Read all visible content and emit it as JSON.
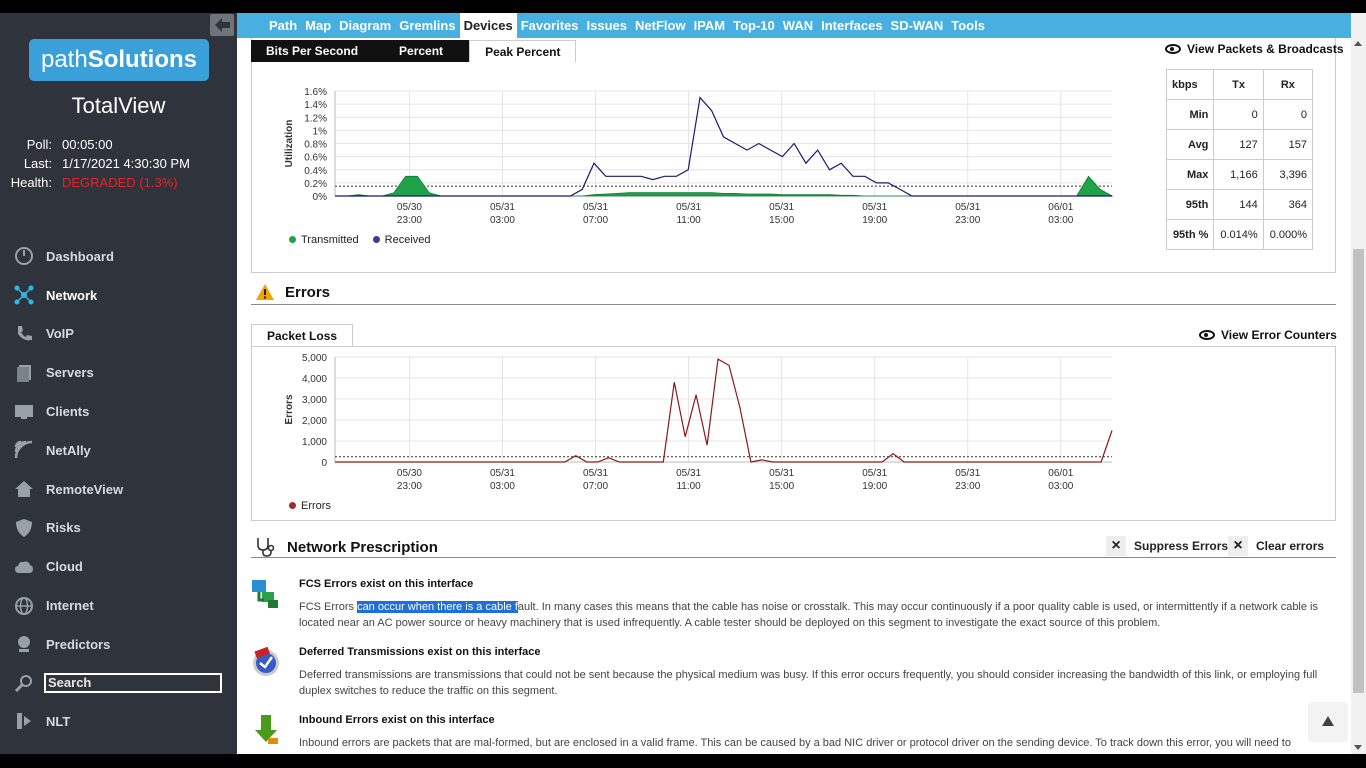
{
  "sidebar": {
    "logo": {
      "part1": "path",
      "part2": "Solutions"
    },
    "product": "TotalView",
    "poll_label": "Poll:",
    "poll_value": "00:05:00",
    "last_label": "Last:",
    "last_value": "1/17/2021 4:30:30 PM",
    "health_label": "Health:",
    "health_value": "DEGRADED (1.3%)",
    "items": [
      {
        "label": "Dashboard",
        "icon": "gauge-icon"
      },
      {
        "label": "Network",
        "icon": "network-icon"
      },
      {
        "label": "VoIP",
        "icon": "phone-icon"
      },
      {
        "label": "Servers",
        "icon": "server-icon"
      },
      {
        "label": "Clients",
        "icon": "monitor-icon"
      },
      {
        "label": "NetAlly",
        "icon": "signal-icon"
      },
      {
        "label": "RemoteView",
        "icon": "home-icon"
      },
      {
        "label": "Risks",
        "icon": "shield-icon"
      },
      {
        "label": "Cloud",
        "icon": "cloud-icon"
      },
      {
        "label": "Internet",
        "icon": "globe-icon"
      },
      {
        "label": "Predictors",
        "icon": "predictor-icon"
      }
    ],
    "search_placeholder": "Search",
    "nlt_label": "NLT"
  },
  "topnav": [
    "Path",
    "Map",
    "Diagram",
    "Gremlins",
    "Devices",
    "Favorites",
    "Issues",
    "NetFlow",
    "IPAM",
    "Top-10",
    "WAN",
    "Interfaces",
    "SD-WAN",
    "Tools"
  ],
  "utilization": {
    "tabs": [
      "Bits Per Second",
      "Percent",
      "Peak Percent"
    ],
    "view_link": "View Packets & Broadcasts",
    "ylabel": "Utilization",
    "legend": [
      "Transmitted",
      "Received"
    ],
    "table": {
      "headers": [
        "kbps",
        "Tx",
        "Rx"
      ],
      "rows": [
        [
          "Min",
          "0",
          "0"
        ],
        [
          "Avg",
          "127",
          "157"
        ],
        [
          "Max",
          "1,166",
          "3,396"
        ],
        [
          "95th",
          "144",
          "364"
        ],
        [
          "95th %",
          "0.014%",
          "0.000%"
        ]
      ]
    }
  },
  "errors": {
    "title": "Errors",
    "tab": "Packet Loss",
    "view_link": "View Error Counters",
    "ylabel": "Errors",
    "legend": [
      "Errors"
    ]
  },
  "prescription": {
    "title": "Network Prescription",
    "suppress": "Suppress Errors",
    "clear": "Clear errors",
    "items": [
      {
        "title": "FCS Errors exist on this interface",
        "body_pre": "FCS Errors ",
        "body_hl": "can occur when there is a cable f",
        "body_post": "ault. In many cases this means that the cable has noise or crosstalk. This may occur continuously if a poor quality cable is used, or intermittently if a network cable is located near an AC power source or heavy machinery that is used infrequently. A cable tester should be deployed on this segment to investigate the exact source of this problem."
      },
      {
        "title": "Deferred Transmissions exist on this interface",
        "body": "Deferred transmissions are transmissions that could not be sent because the physical medium was busy. If this error occurs frequently, you should consider increasing the bandwidth of this link, or employing full duplex switches to reduce the traffic on this segment."
      },
      {
        "title": "Inbound Errors exist on this interface",
        "body": "Inbound errors are packets that are mal-formed, but are enclosed in a valid frame. This can be caused by a bad NIC driver or protocol driver on the sending device. To track down this error, you will need to"
      }
    ]
  },
  "chart_data": [
    {
      "type": "area",
      "ylabel": "Utilization",
      "y_ticks": [
        "0%",
        "0.2%",
        "0.4%",
        "0.6%",
        "0.8%",
        "1%",
        "1.2%",
        "1.4%",
        "1.6%"
      ],
      "ylim": [
        0,
        1.6
      ],
      "x_ticks": [
        [
          "05/30",
          "23:00"
        ],
        [
          "05/31",
          "03:00"
        ],
        [
          "05/31",
          "07:00"
        ],
        [
          "05/31",
          "11:00"
        ],
        [
          "05/31",
          "15:00"
        ],
        [
          "05/31",
          "19:00"
        ],
        [
          "05/31",
          "23:00"
        ],
        [
          "06/01",
          "03:00"
        ]
      ],
      "series": [
        {
          "name": "Transmitted",
          "color": "#1fa24a",
          "values": [
            0,
            0,
            0.02,
            0,
            0,
            0.05,
            0.3,
            0.3,
            0.05,
            0,
            0,
            0,
            0,
            0,
            0,
            0,
            0,
            0,
            0,
            0,
            0,
            0,
            0.02,
            0.03,
            0.04,
            0.05,
            0.05,
            0.05,
            0.05,
            0.05,
            0.05,
            0.05,
            0.05,
            0.04,
            0.04,
            0.03,
            0.03,
            0.03,
            0.02,
            0.02,
            0.02,
            0.02,
            0.02,
            0.01,
            0.01,
            0,
            0,
            0,
            0,
            0,
            0,
            0,
            0,
            0,
            0,
            0,
            0,
            0,
            0,
            0,
            0,
            0,
            0,
            0,
            0.3,
            0.1,
            0
          ]
        },
        {
          "name": "Received",
          "color": "#1b1a6e",
          "values": [
            0,
            0,
            0,
            0,
            0,
            0,
            0,
            0,
            0,
            0,
            0,
            0,
            0,
            0,
            0,
            0,
            0,
            0,
            0,
            0,
            0,
            0.1,
            0.5,
            0.3,
            0.3,
            0.3,
            0.3,
            0.25,
            0.3,
            0.3,
            0.4,
            1.5,
            1.3,
            0.9,
            0.8,
            0.7,
            0.8,
            0.7,
            0.6,
            0.8,
            0.5,
            0.7,
            0.4,
            0.5,
            0.3,
            0.3,
            0.2,
            0.2,
            0.1,
            0,
            0,
            0,
            0,
            0,
            0,
            0,
            0,
            0,
            0,
            0,
            0,
            0,
            0,
            0,
            0,
            0,
            0
          ]
        }
      ],
      "threshold": 0.15
    },
    {
      "type": "line",
      "ylabel": "Errors",
      "y_ticks": [
        "0",
        "1,000",
        "2,000",
        "3,000",
        "4,000",
        "5,000"
      ],
      "ylim": [
        0,
        5000
      ],
      "x_ticks": [
        [
          "05/30",
          "23:00"
        ],
        [
          "05/31",
          "03:00"
        ],
        [
          "05/31",
          "07:00"
        ],
        [
          "05/31",
          "11:00"
        ],
        [
          "05/31",
          "15:00"
        ],
        [
          "05/31",
          "19:00"
        ],
        [
          "05/31",
          "23:00"
        ],
        [
          "06/01",
          "03:00"
        ]
      ],
      "series": [
        {
          "name": "Errors",
          "color": "#8b1a1a",
          "values": [
            0,
            0,
            0,
            0,
            0,
            0,
            0,
            0,
            0,
            0,
            0,
            0,
            0,
            0,
            0,
            0,
            0,
            0,
            0,
            0,
            0,
            0,
            300,
            0,
            0,
            200,
            0,
            0,
            0,
            0,
            0,
            3800,
            1200,
            3200,
            800,
            4900,
            4600,
            2600,
            0,
            100,
            0,
            0,
            0,
            0,
            0,
            0,
            0,
            0,
            0,
            0,
            0,
            400,
            0,
            0,
            0,
            0,
            0,
            0,
            0,
            0,
            0,
            0,
            0,
            0,
            0,
            0,
            0,
            0,
            0,
            0,
            0,
            1500
          ]
        }
      ],
      "threshold": 250
    }
  ]
}
